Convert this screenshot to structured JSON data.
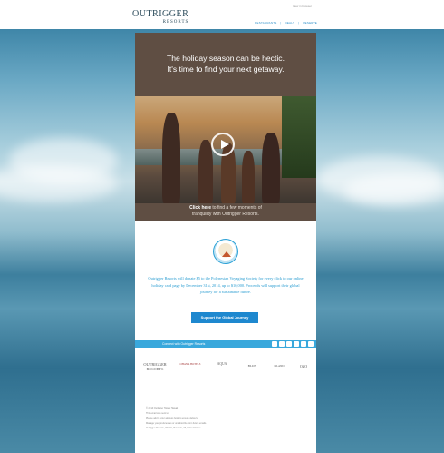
{
  "header": {
    "logo_main": "OUTRIGGER",
    "logo_sub": "RESORTS",
    "top_link": "View in browser",
    "nav": [
      "RESTAURANTS",
      "DEALS",
      "RESERVE"
    ]
  },
  "hero": {
    "title_line1": "The holiday season can be hectic.",
    "title_line2": "It's time to find your next getaway.",
    "cta_bold": "Click here",
    "cta_line1_rest": " to find a few moments of",
    "cta_line2": "tranquility with Outrigger Resorts."
  },
  "body": {
    "text": "Outrigger Resorts will donate $5 to the Polynesian Voyaging Society for every click to our online holiday card page by December 31st, 2014, up to $10,000. Proceeds will support their global journey for a sustainable future.",
    "button_label": "Support the Global Journey"
  },
  "connect": {
    "label": "Connect with Outrigger Resorts",
    "icons": [
      "facebook-icon",
      "twitter-icon",
      "pinterest-icon",
      "instagram-icon",
      "youtube-icon",
      "googleplus-icon"
    ]
  },
  "brands": [
    "OUTRIGGER RESORTS",
    "OHANA HOTELS",
    "AQUA",
    "BLUE",
    "ISLAND",
    "OZO"
  ],
  "footer": [
    "© 2014 Outrigger Hotels Hawaii",
    "This email was sent to",
    "Please add to your address book to ensure delivery.",
    "Manage your preferences or unsubscribe from future emails.",
    "Outrigger Resorts, Waikiki, Honolulu, HI, United States"
  ],
  "colors": {
    "hero_bg": "#5f4e43",
    "accent_blue": "#1e88cf",
    "text_blue": "#2b9dd1"
  }
}
